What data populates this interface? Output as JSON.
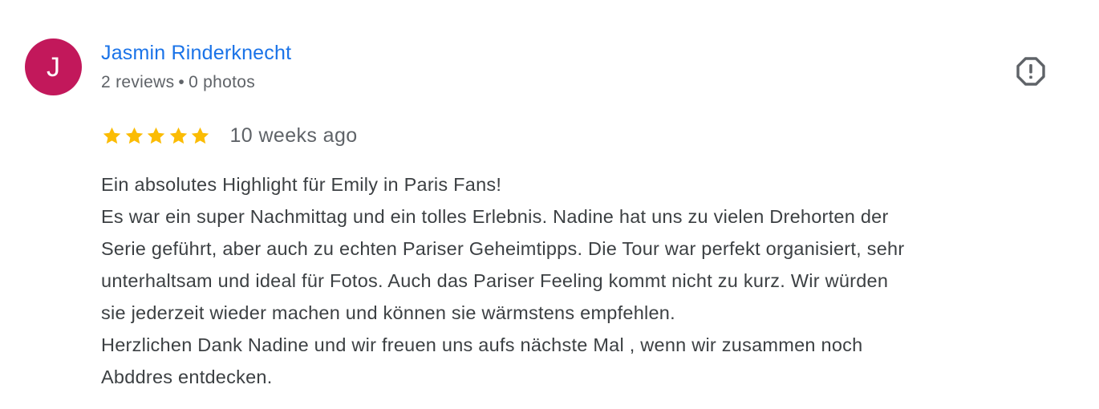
{
  "review": {
    "avatar": {
      "initial": "J",
      "color": "#c2185b"
    },
    "reviewer_name": "Jasmin Rinderknecht",
    "reviews_count": "2 reviews",
    "meta_separator": "•",
    "photos_count": "0 photos",
    "report_icon": "report-exclamation-octagon-icon",
    "rating": {
      "value": 5,
      "max": 5,
      "star_color": "#fbbc04"
    },
    "date": "10 weeks ago",
    "text_lines": [
      "Ein absolutes Highlight für Emily in Paris Fans!",
      "Es war ein super Nachmittag und ein tolles Erlebnis. Nadine hat uns zu vielen Drehorten der",
      "Serie geführt, aber auch zu echten Pariser Geheimtipps. Die Tour war perfekt organisiert, sehr",
      "unterhaltsam und ideal für Fotos. Auch das Pariser Feeling kommt nicht zu kurz. Wir würden",
      "sie jederzeit wieder machen und können sie wärmstens empfehlen.",
      "Herzlichen Dank Nadine und wir freuen uns aufs nächste Mal , wenn wir zusammen noch",
      "Abddres entdecken."
    ]
  }
}
